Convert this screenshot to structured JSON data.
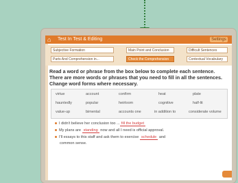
{
  "window": {
    "title": "Test In Test & Editing",
    "right_button": "Settings"
  },
  "toolbar": {
    "row1": [
      "Subjective Formation",
      "Main Point and Conclusion",
      "Difficult Sentences"
    ],
    "row2": [
      "Parts And Comprehension in...",
      "Check the Comprehension",
      "Contextual Vocabulary"
    ]
  },
  "instructions": "Read a word or phrase from the box below to complete each sentence. There are more words or phrases that you need to fill in all the sentences. Change word forms where necessary.",
  "word_bank": {
    "row1": [
      "virtue",
      "account",
      "confirm",
      "heat",
      "plate"
    ],
    "row2": [
      "hauntedly",
      "popular",
      "heirloom",
      "cognitive",
      "half-lit"
    ],
    "row3": [
      "value-up",
      "bimental",
      "accounts one",
      "in addition to",
      "considerate volume"
    ]
  },
  "questions": [
    {
      "pre": "I didn't believe her conclusion too ...",
      "answer": "fill the budget",
      "post": ""
    },
    {
      "pre": "My plans are ",
      "answer": "standing",
      "post": " now and all I need is official approval."
    },
    {
      "pre": "I'll essays to this staff and ask them to exercise ",
      "answer": "schedule",
      "post": " and"
    },
    {
      "pre": "common sense.",
      "answer": "",
      "post": ""
    }
  ]
}
